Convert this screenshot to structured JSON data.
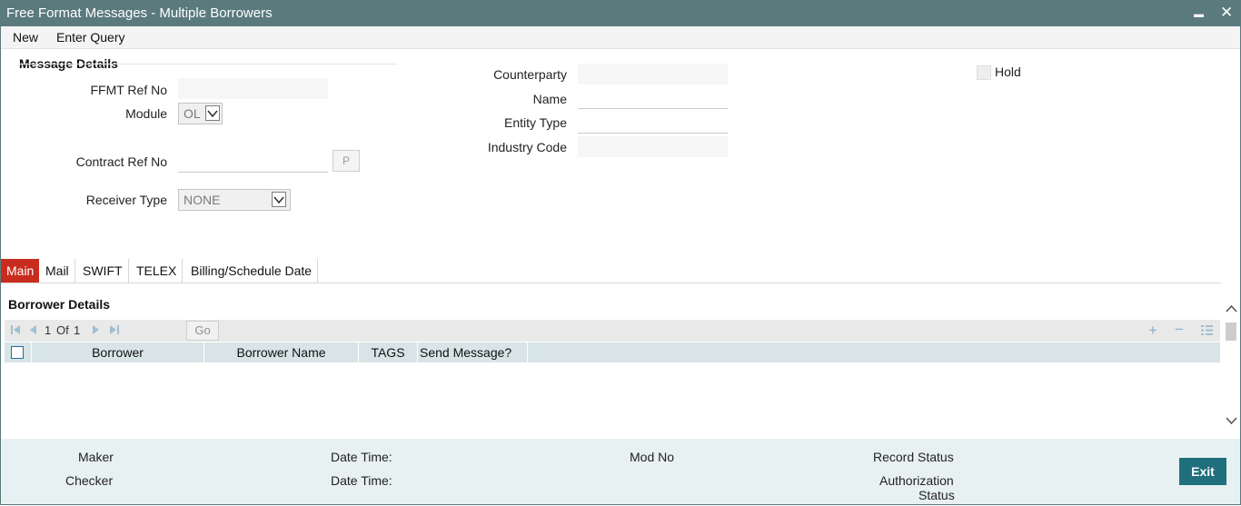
{
  "window": {
    "title": "Free Format Messages - Multiple Borrowers",
    "minimize": "▬",
    "close": "✕"
  },
  "menu": {
    "new": "New",
    "enter_query": "Enter Query"
  },
  "message_details": {
    "section_title": "Message Details",
    "ffmt_ref_no_label": "FFMT Ref No",
    "ffmt_ref_no_value": "",
    "module_label": "Module",
    "module_value": "OL",
    "contract_ref_no_label": "Contract Ref No",
    "contract_ref_no_value": "",
    "p_button": "P",
    "receiver_type_label": "Receiver Type",
    "receiver_type_value": "NONE",
    "counterparty_label": "Counterparty",
    "counterparty_value": "",
    "name_label": "Name",
    "name_value": "",
    "entity_type_label": "Entity Type",
    "entity_type_value": "",
    "industry_code_label": "Industry Code",
    "industry_code_value": "",
    "hold_label": "Hold",
    "hold_checked": false
  },
  "tabs": [
    {
      "label": "Main",
      "active": true
    },
    {
      "label": "Mail"
    },
    {
      "label": "SWIFT"
    },
    {
      "label": "TELEX"
    },
    {
      "label": "Billing/Schedule Date"
    }
  ],
  "borrower": {
    "section_title": "Borrower Details",
    "pagination": {
      "current": "1",
      "of_label": "Of",
      "total": "1",
      "go": "Go"
    },
    "columns": [
      "Borrower",
      "Borrower Name",
      "TAGS",
      "Send Message?"
    ],
    "rows": []
  },
  "footer": {
    "maker": "Maker",
    "date_time_1": "Date Time:",
    "mod_no": "Mod No",
    "record_status": "Record Status",
    "checker": "Checker",
    "date_time_2": "Date Time:",
    "authorization_status_line1": "Authorization",
    "authorization_status_line2": "Status",
    "exit": "Exit"
  },
  "colors": {
    "titlebar": "#5a7a7e",
    "active_tab": "#c72c1e",
    "exit_button": "#1f6f7d",
    "footer_bg": "#e8f1f1",
    "grid_header": "#d8e4e6"
  }
}
